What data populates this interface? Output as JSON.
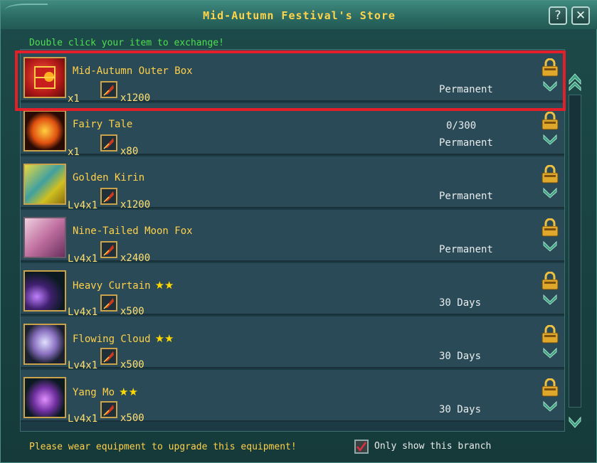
{
  "window": {
    "title": "Mid-Autumn Festival's Store",
    "help_label": "?",
    "close_label": "✕"
  },
  "hint": "Double click your item to exchange!",
  "items": [
    {
      "name": "Mid-Autumn Outer Box",
      "stars": "",
      "qty": "x1",
      "cost": "x1200",
      "limit": "",
      "duration": "Permanent",
      "icon": "gift-box-icon"
    },
    {
      "name": "Fairy Tale",
      "stars": "",
      "qty": "x1",
      "cost": "x80",
      "limit": "0/300",
      "duration": "Permanent",
      "icon": "fire-orb-icon"
    },
    {
      "name": "Golden Kirin",
      "stars": "",
      "qty": "Lv4x1",
      "cost": "x1200",
      "limit": "",
      "duration": "Permanent",
      "icon": "kirin-mount-icon"
    },
    {
      "name": "Nine-Tailed Moon Fox",
      "stars": "",
      "qty": "Lv4x1",
      "cost": "x2400",
      "limit": "",
      "duration": "Permanent",
      "icon": "fox-mount-icon"
    },
    {
      "name": "Heavy Curtain",
      "stars": "★★",
      "qty": "Lv4x1",
      "cost": "x500",
      "limit": "",
      "duration": "30 Days",
      "icon": "purple-wings-icon"
    },
    {
      "name": "Flowing Cloud",
      "stars": "★★",
      "qty": "Lv4x1",
      "cost": "x500",
      "limit": "",
      "duration": "30 Days",
      "icon": "cloud-wings-icon"
    },
    {
      "name": "Yang Mo",
      "stars": "★★",
      "qty": "Lv4x1",
      "cost": "x500",
      "limit": "",
      "duration": "30 Days",
      "icon": "violet-wings-icon"
    }
  ],
  "footer": {
    "note": "Please wear equipment to upgrade this equipment!",
    "checkbox_label": "Only show this branch",
    "checkbox_checked": true
  },
  "colors": {
    "selection": "#e3202a",
    "name_text": "#ffd14a",
    "hint_text": "#4ee04e"
  }
}
